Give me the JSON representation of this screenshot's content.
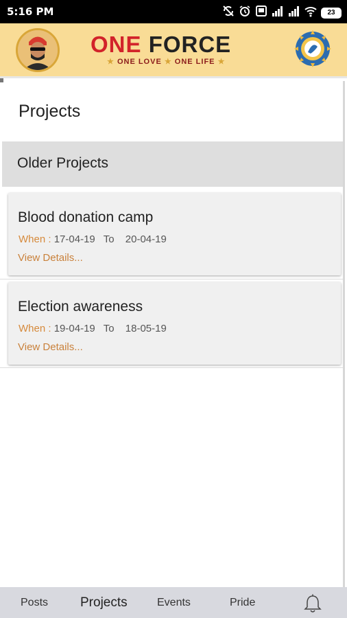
{
  "status_bar": {
    "time": "5:16 PM",
    "battery": "23",
    "icons": [
      "sync-off-icon",
      "alarm-icon",
      "notification-icon",
      "signal-icon",
      "signal-icon",
      "wifi-icon",
      "battery-icon"
    ]
  },
  "header": {
    "logo_one": "ONE",
    "logo_force": "FORCE",
    "logo_tagline_1": "ONE LOVE",
    "logo_tagline_2": "ONE LIFE",
    "brand_color": "#d2232a",
    "header_bg": "#f9dc96"
  },
  "page": {
    "title": "Projects",
    "section_label": "Older Projects"
  },
  "projects": [
    {
      "title": "Blood donation camp",
      "when_label": "When :",
      "start": "17-04-19",
      "to_label": "To",
      "end": "20-04-19",
      "details_link": "View Details..."
    },
    {
      "title": "Election awareness",
      "when_label": "When :",
      "start": "19-04-19",
      "to_label": "To",
      "end": "18-05-19",
      "details_link": "View Details..."
    }
  ],
  "bottom_nav": {
    "posts": "Posts",
    "projects": "Projects",
    "events": "Events",
    "pride": "Pride",
    "active": "projects"
  }
}
